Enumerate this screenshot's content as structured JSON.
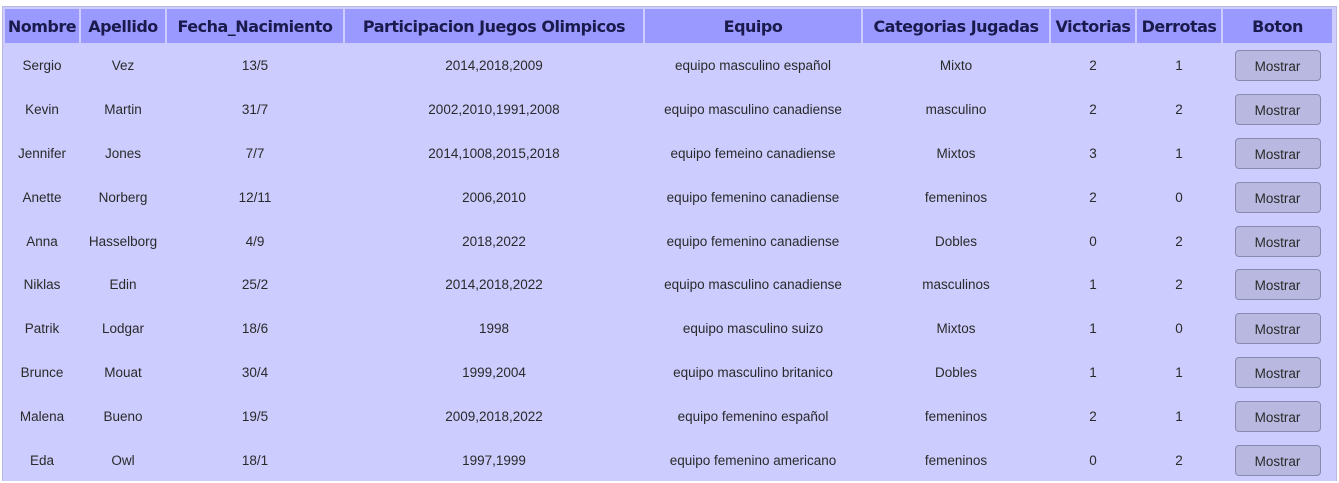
{
  "table": {
    "headers": [
      "Nombre",
      "Apellido",
      "Fecha_Nacimiento",
      "Participacion Juegos Olimpicos",
      "Equipo",
      "Categorias Jugadas",
      "Victorias",
      "Derrotas",
      "Boton"
    ],
    "rows": [
      {
        "nombre": "Sergio",
        "apellido": "Vez",
        "fecha": "13/5",
        "participacion": "2014,2018,2009",
        "equipo": "equipo masculino español",
        "categorias": "Mixto",
        "victorias": "2",
        "derrotas": "1",
        "boton": "Mostrar"
      },
      {
        "nombre": "Kevin",
        "apellido": "Martin",
        "fecha": "31/7",
        "participacion": "2002,2010,1991,2008",
        "equipo": "equipo masculino canadiense",
        "categorias": "masculino",
        "victorias": "2",
        "derrotas": "2",
        "boton": "Mostrar"
      },
      {
        "nombre": "Jennifer",
        "apellido": "Jones",
        "fecha": "7/7",
        "participacion": "2014,1008,2015,2018",
        "equipo": "equipo femeino canadiense",
        "categorias": "Mixtos",
        "victorias": "3",
        "derrotas": "1",
        "boton": "Mostrar"
      },
      {
        "nombre": "Anette",
        "apellido": "Norberg",
        "fecha": "12/11",
        "participacion": "2006,2010",
        "equipo": "equipo femenino canadiense",
        "categorias": "femeninos",
        "victorias": "2",
        "derrotas": "0",
        "boton": "Mostrar"
      },
      {
        "nombre": "Anna",
        "apellido": "Hasselborg",
        "fecha": "4/9",
        "participacion": "2018,2022",
        "equipo": "equipo femenino canadiense",
        "categorias": "Dobles",
        "victorias": "0",
        "derrotas": "2",
        "boton": "Mostrar"
      },
      {
        "nombre": "Niklas",
        "apellido": "Edin",
        "fecha": "25/2",
        "participacion": "2014,2018,2022",
        "equipo": "equipo masculino canadiense",
        "categorias": "masculinos",
        "victorias": "1",
        "derrotas": "2",
        "boton": "Mostrar"
      },
      {
        "nombre": "Patrik",
        "apellido": "Lodgar",
        "fecha": "18/6",
        "participacion": "1998",
        "equipo": "equipo masculino suizo",
        "categorias": "Mixtos",
        "victorias": "1",
        "derrotas": "0",
        "boton": "Mostrar"
      },
      {
        "nombre": "Brunce",
        "apellido": "Mouat",
        "fecha": "30/4",
        "participacion": "1999,2004",
        "equipo": "equipo masculino britanico",
        "categorias": "Dobles",
        "victorias": "1",
        "derrotas": "1",
        "boton": "Mostrar"
      },
      {
        "nombre": "Malena",
        "apellido": "Bueno",
        "fecha": "19/5",
        "participacion": "2009,2018,2022",
        "equipo": "equipo femenino español",
        "categorias": "femeninos",
        "victorias": "2",
        "derrotas": "1",
        "boton": "Mostrar"
      },
      {
        "nombre": "Eda",
        "apellido": "Owl",
        "fecha": "18/1",
        "participacion": "1997,1999",
        "equipo": "equipo femenino americano",
        "categorias": "femeninos",
        "victorias": "0",
        "derrotas": "2",
        "boton": "Mostrar"
      }
    ]
  },
  "colors": {
    "header_bg": "#9999ff",
    "table_bg": "#ccccff",
    "button_bg": "#b8b8e0"
  }
}
